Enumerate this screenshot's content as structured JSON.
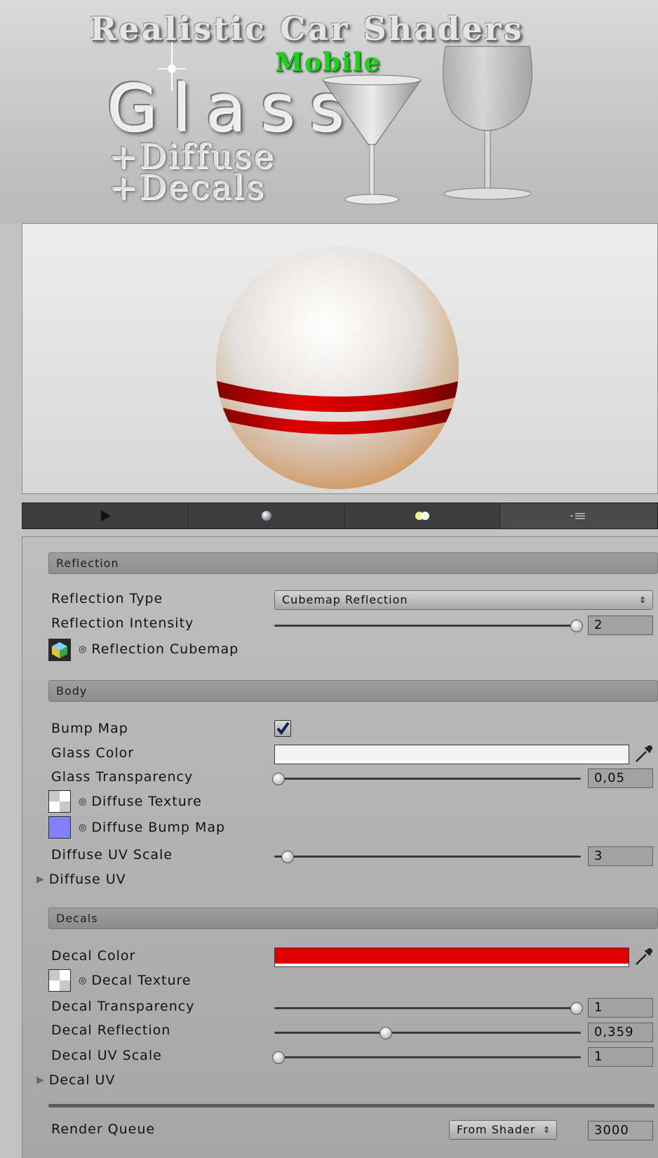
{
  "banner": {
    "title": "Realistic Car Shaders",
    "subtitle": "Mobile",
    "word": "Glass",
    "extra1": "+Diffuse",
    "extra2": "+Decals"
  },
  "toolbar": {
    "buttons": [
      "play-icon",
      "sphere-icon",
      "light-icon",
      "settings-menu-icon"
    ]
  },
  "sections": {
    "reflection": "Reflection",
    "body": "Body",
    "decals": "Decals"
  },
  "reflection": {
    "type_label": "Reflection Type",
    "type_value": "Cubemap Reflection",
    "intensity_label": "Reflection Intensity",
    "intensity_value": "2",
    "intensity_fraction": 1.0,
    "cubemap_label": "Reflection Cubemap"
  },
  "body": {
    "bump_label": "Bump Map",
    "bump_checked": true,
    "glass_color_label": "Glass Color",
    "glass_color": "#f4f4f4",
    "transparency_label": "Glass Transparency",
    "transparency_value": "0,05",
    "transparency_fraction": 0.0,
    "diffuse_texture_label": "Diffuse Texture",
    "diffuse_bump_label": "Diffuse Bump Map",
    "diffuse_bump_color": "#8080ff",
    "uv_scale_label": "Diffuse UV Scale",
    "uv_scale_value": "3",
    "uv_scale_fraction": 0.03,
    "uv_foldout": "Diffuse UV"
  },
  "decals": {
    "color_label": "Decal Color",
    "color": "#e00000",
    "texture_label": "Decal Texture",
    "transparency_label": "Decal Transparency",
    "transparency_value": "1",
    "transparency_fraction": 1.0,
    "reflection_label": "Decal Reflection",
    "reflection_value": "0,359",
    "reflection_fraction": 0.359,
    "uv_scale_label": "Decal UV Scale",
    "uv_scale_value": "1",
    "uv_scale_fraction": 0.0,
    "uv_foldout": "Decal UV"
  },
  "render_queue": {
    "label": "Render Queue",
    "mode": "From Shader",
    "value": "3000"
  }
}
